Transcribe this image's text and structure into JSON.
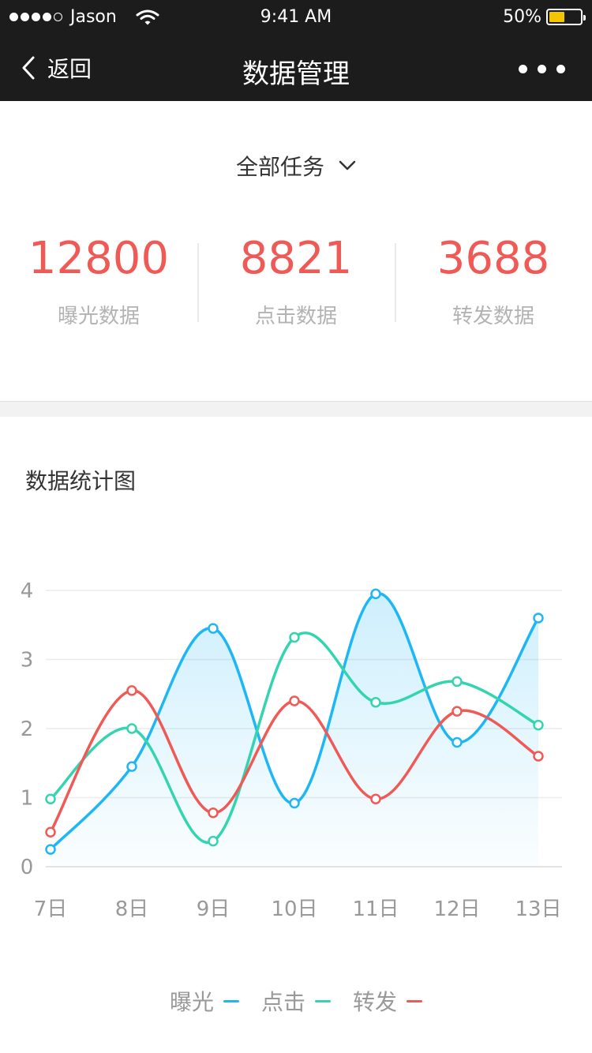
{
  "status_bar": {
    "carrier": "Jason",
    "time": "9:41 AM",
    "battery": "50%",
    "battery_level": 0.5
  },
  "nav": {
    "back_label": "返回",
    "title": "数据管理"
  },
  "filter": {
    "label": "全部任务"
  },
  "stats": [
    {
      "value": "12800",
      "label": "曝光数据"
    },
    {
      "value": "8821",
      "label": "点击数据"
    },
    {
      "value": "3688",
      "label": "转发数据"
    }
  ],
  "chart_title": "数据统计图",
  "colors": {
    "accent": "#f05a56",
    "exposure": "#1eb6f5",
    "click": "#35d4b0",
    "forward": "#f05a56"
  },
  "chart_data": {
    "type": "line",
    "categories": [
      "7日",
      "8日",
      "9日",
      "10日",
      "11日",
      "12日",
      "13日"
    ],
    "yticks": [
      "0",
      "1",
      "2",
      "3",
      "4"
    ],
    "ylim": [
      0,
      4
    ],
    "grid": true,
    "legend_position": "bottom",
    "series": [
      {
        "name": "曝光",
        "color": "#1eb6f5",
        "area": true,
        "values": [
          0.25,
          1.45,
          3.45,
          0.92,
          3.95,
          1.8,
          3.6
        ]
      },
      {
        "name": "点击",
        "color": "#35d4b0",
        "values": [
          0.98,
          2.0,
          0.37,
          3.32,
          2.38,
          2.68,
          2.05
        ]
      },
      {
        "name": "转发",
        "color": "#f05a56",
        "values": [
          0.5,
          2.55,
          0.78,
          2.4,
          0.98,
          2.25,
          1.6
        ]
      }
    ]
  }
}
